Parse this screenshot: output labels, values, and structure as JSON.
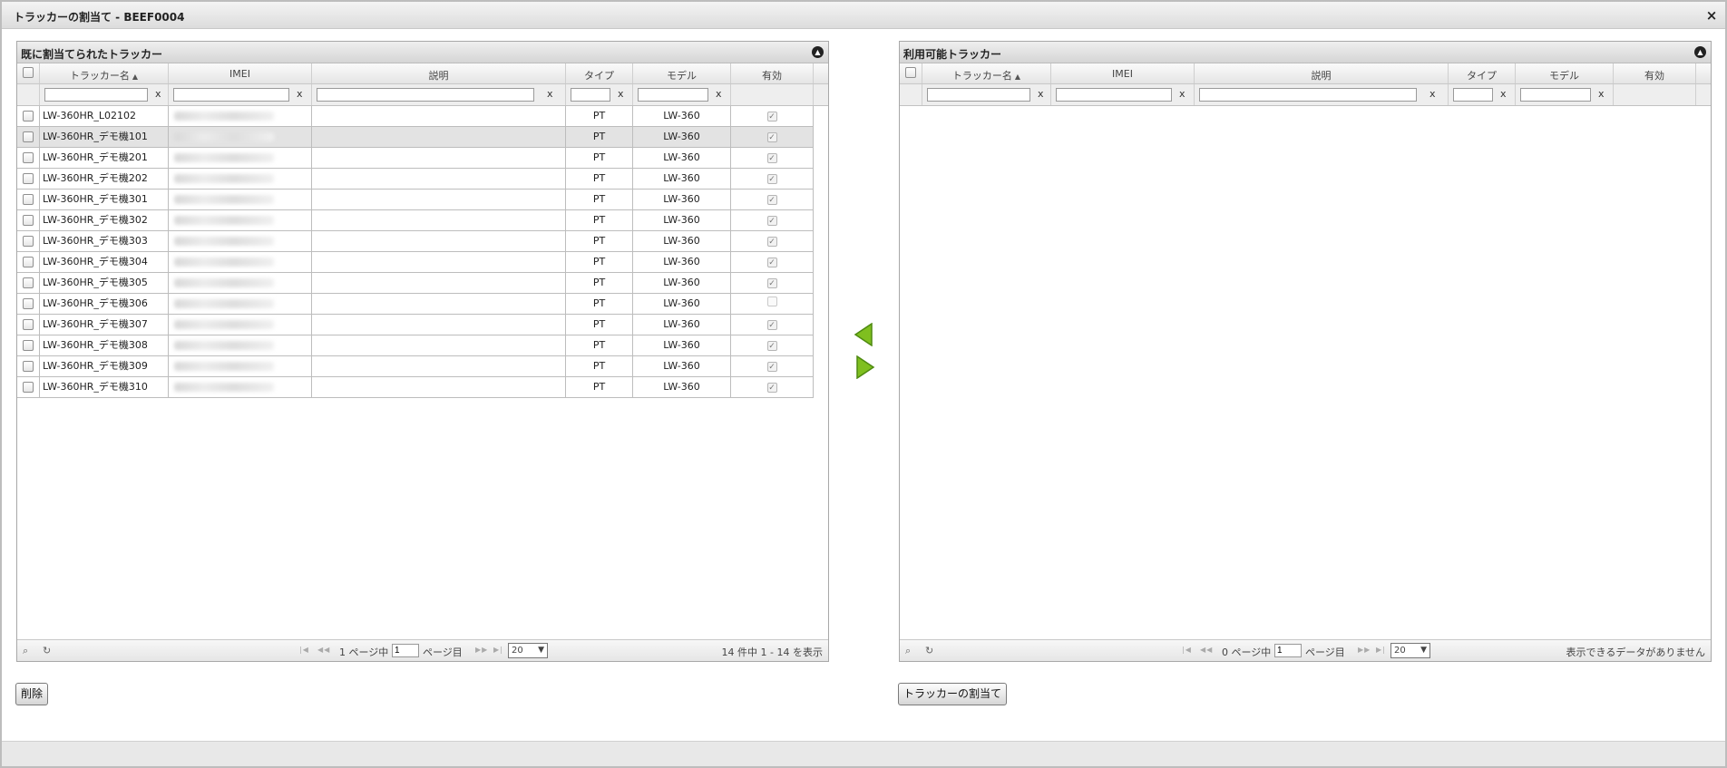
{
  "dialog": {
    "title": "トラッカーの割当て - BEEF0004",
    "close_label": "×"
  },
  "columns": {
    "name": "トラッカー名",
    "imei": "IMEI",
    "description": "説明",
    "type": "タイプ",
    "model": "モデル",
    "enabled": "有効",
    "clear": "x"
  },
  "assigned": {
    "title": "既に割当てられたトラッカー",
    "rows": [
      {
        "name": "LW-360HR_L02102",
        "type": "PT",
        "model": "LW-360",
        "enabled": true,
        "selected": false
      },
      {
        "name": "LW-360HR_デモ機101",
        "type": "PT",
        "model": "LW-360",
        "enabled": true,
        "selected": true
      },
      {
        "name": "LW-360HR_デモ機201",
        "type": "PT",
        "model": "LW-360",
        "enabled": true,
        "selected": false
      },
      {
        "name": "LW-360HR_デモ機202",
        "type": "PT",
        "model": "LW-360",
        "enabled": true,
        "selected": false
      },
      {
        "name": "LW-360HR_デモ機301",
        "type": "PT",
        "model": "LW-360",
        "enabled": true,
        "selected": false
      },
      {
        "name": "LW-360HR_デモ機302",
        "type": "PT",
        "model": "LW-360",
        "enabled": true,
        "selected": false
      },
      {
        "name": "LW-360HR_デモ機303",
        "type": "PT",
        "model": "LW-360",
        "enabled": true,
        "selected": false
      },
      {
        "name": "LW-360HR_デモ機304",
        "type": "PT",
        "model": "LW-360",
        "enabled": true,
        "selected": false
      },
      {
        "name": "LW-360HR_デモ機305",
        "type": "PT",
        "model": "LW-360",
        "enabled": true,
        "selected": false
      },
      {
        "name": "LW-360HR_デモ機306",
        "type": "PT",
        "model": "LW-360",
        "enabled": false,
        "selected": false
      },
      {
        "name": "LW-360HR_デモ機307",
        "type": "PT",
        "model": "LW-360",
        "enabled": true,
        "selected": false
      },
      {
        "name": "LW-360HR_デモ機308",
        "type": "PT",
        "model": "LW-360",
        "enabled": true,
        "selected": false
      },
      {
        "name": "LW-360HR_デモ機309",
        "type": "PT",
        "model": "LW-360",
        "enabled": true,
        "selected": false
      },
      {
        "name": "LW-360HR_デモ機310",
        "type": "PT",
        "model": "LW-360",
        "enabled": true,
        "selected": false
      }
    ],
    "pager": {
      "page_prefix": "1 ページ中",
      "current_page": "1",
      "page_suffix": "ページ目",
      "rows_per_page": "20",
      "info": "14 件中 1 - 14 を表示"
    },
    "delete_button": "削除"
  },
  "available": {
    "title": "利用可能トラッカー",
    "pager": {
      "page_prefix": "0 ページ中",
      "current_page": "1",
      "page_suffix": "ページ目",
      "rows_per_page": "20",
      "info": "表示できるデータがありません"
    },
    "assign_button": "トラッカーの割当て"
  },
  "colors": {
    "arrow_green": "#7fbf1f",
    "arrow_dark": "#4e8a10"
  },
  "icons": {
    "search": "search-icon",
    "refresh": "refresh-icon",
    "move_left": "arrow-left-icon",
    "move_right": "arrow-right-icon"
  }
}
